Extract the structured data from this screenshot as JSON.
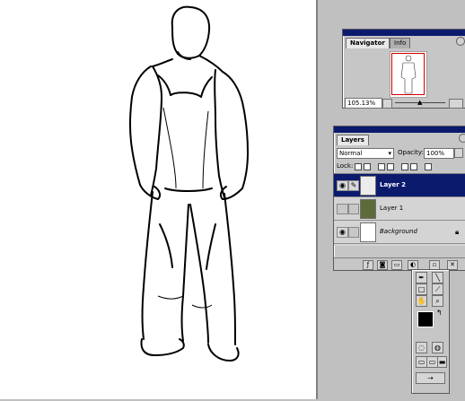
{
  "navigator": {
    "tab_active": "Navigator",
    "tab_inactive": "Info",
    "zoom_value": "105.13%"
  },
  "layers": {
    "tab": "Layers",
    "blend_mode": "Normal",
    "opacity_label": "Opacity:",
    "opacity_value": "100%",
    "lock_label": "Lock:",
    "items": [
      {
        "name": "Layer 2",
        "selected": true
      },
      {
        "name": "Layer 1",
        "selected": false
      },
      {
        "name": "Background",
        "selected": false
      }
    ]
  },
  "icons": [
    "eye-icon",
    "paintbrush-icon",
    "lock-icon",
    "trash-icon",
    "new-layer-icon",
    "hand-icon",
    "zoom-icon",
    "eyedropper-icon"
  ],
  "colors": {
    "titlebar": "#0c1a6e",
    "selection": "#0c1a6e",
    "nav_view_box": "#d00000"
  }
}
